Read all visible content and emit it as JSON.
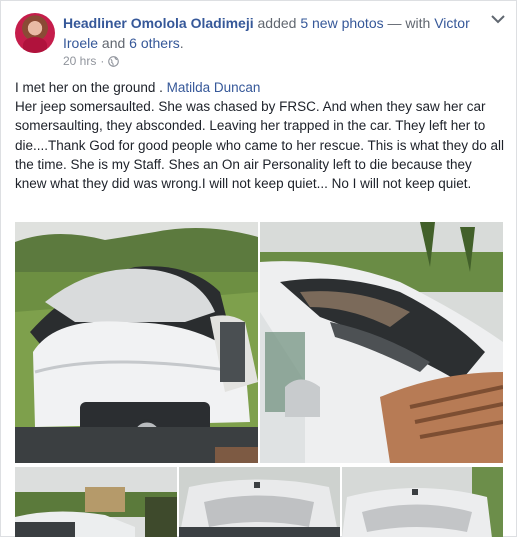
{
  "post": {
    "author": "Headliner Omolola Oladimeji",
    "action": " added ",
    "photos_link": "5 new photos",
    "with_prefix": " — with ",
    "tagged_first": "Victor Iroele",
    "and_text": " and ",
    "others_link": "6 others",
    "period": ".",
    "timestamp": "20 hrs",
    "dot": "·",
    "privacy_icon": "globe-icon",
    "menu_icon": "chevron-down-icon",
    "body_line1_text": "I met her on the ground . ",
    "body_line1_mention": "Matilda Duncan",
    "body_paragraph": "Her jeep somersaulted. She was chased by FRSC. And when they saw her car somersaulting, they absconded. Leaving her trapped in the car. They left her to die....Thank God for good people who came to her rescue. This is what they do all the time. She is my Staff. Shes an On air Personality left to die because they knew what they did was wrong.I will not keep quiet... No I will not keep quiet."
  },
  "colors": {
    "link": "#365899",
    "text": "#1d2129",
    "meta": "#90949c"
  }
}
